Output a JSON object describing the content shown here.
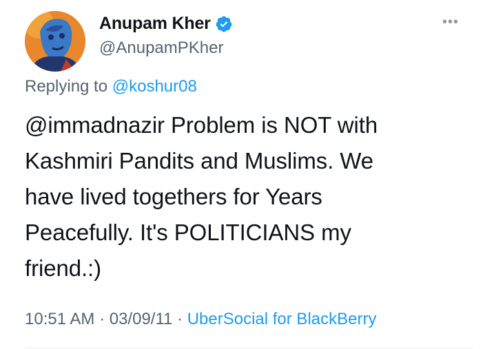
{
  "author": {
    "display_name": "Anupam Kher",
    "handle": "@AnupamPKher",
    "verified": true,
    "avatar_icon": "profile-photo-icon"
  },
  "more_icon": "ellipsis-icon",
  "reply": {
    "prefix": "Replying to ",
    "mention": "@koshur08"
  },
  "tweet_text": "@immadnazir Problem is NOT with\nKashmiri Pandits and Muslims. We\nhave lived togethers for Years\nPeacefully. It's POLITICIANS my\nfriend.:)",
  "meta": {
    "time": "10:51 AM",
    "sep1": " · ",
    "date": "03/09/11",
    "sep2": " · ",
    "source": "UberSocial for BlackBerry"
  },
  "colors": {
    "accent": "#1d9bf0",
    "muted": "#536471",
    "text": "#0f1419"
  }
}
